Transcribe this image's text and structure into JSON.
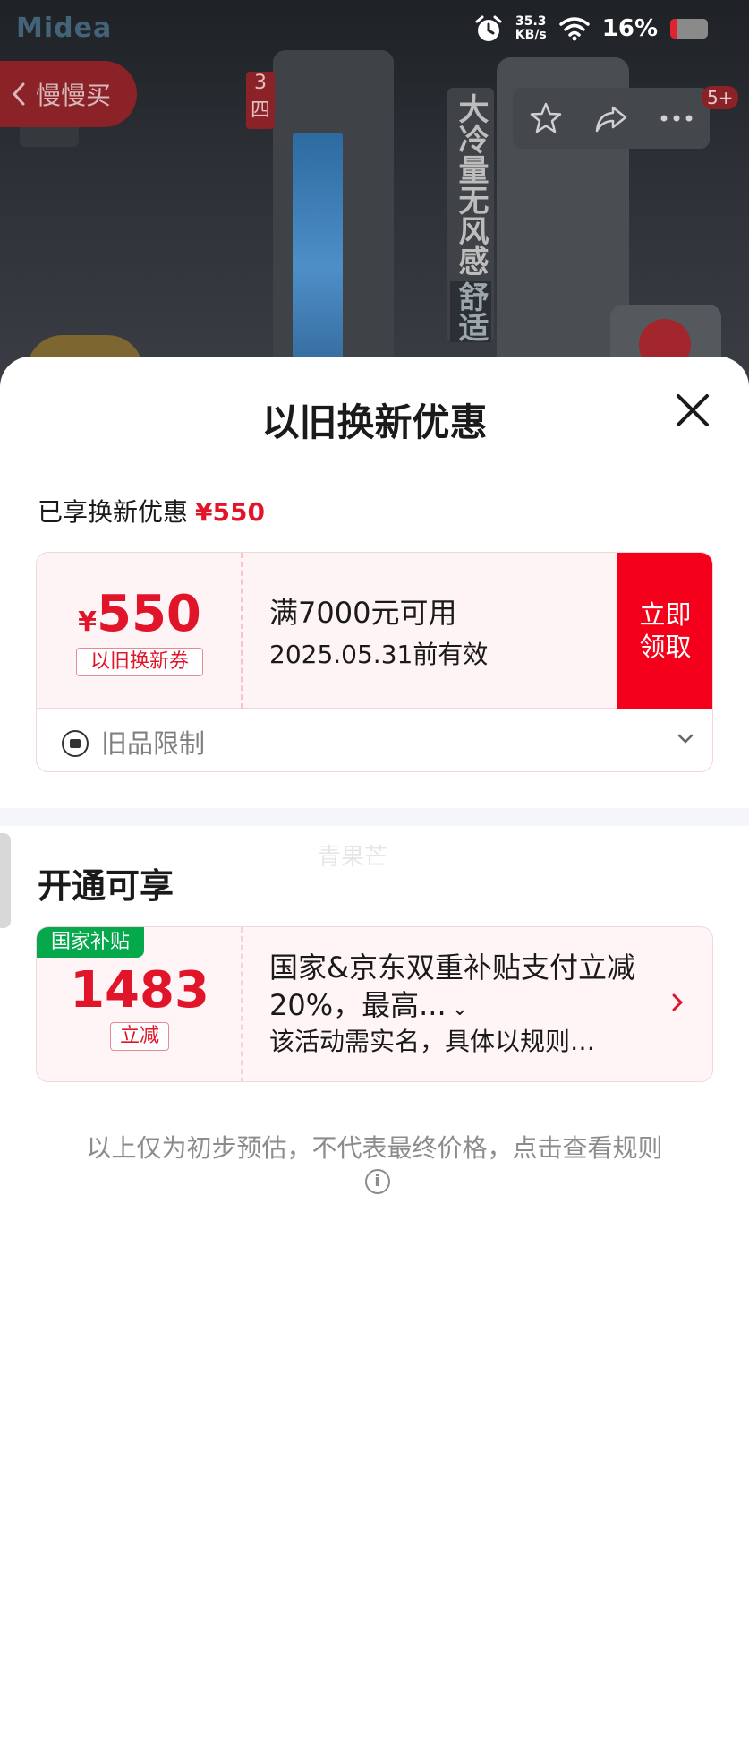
{
  "status_bar": {
    "network_speed_value": "35.3",
    "network_speed_unit": "KB/s",
    "battery_percent": "16%"
  },
  "background": {
    "brand_logo": "Midea",
    "slow_buy_label": "慢慢买",
    "tag_text": "3 四",
    "vertical_text": "大冷量无风感",
    "vertical_text_sub": "舒适",
    "notification_count": "5+"
  },
  "sheet": {
    "title": "以旧换新优惠",
    "enjoyed_label": "已享换新优惠",
    "enjoyed_amount": "¥550",
    "coupon": {
      "currency": "¥",
      "value": "550",
      "tag": "以旧换新券",
      "condition": "满7000元可用",
      "expiry": "2025.05.31前有效",
      "claim_label": "立即领取",
      "restriction_label": "旧品限制"
    },
    "watermark": "青果芒",
    "section_title": "开通可享",
    "subsidy": {
      "tag": "国家补贴",
      "amount": "1483",
      "amount_label": "立减",
      "description": "国家&京东双重补贴支付立减20%，最高...",
      "note": "该活动需实名，具体以规则…"
    },
    "disclaimer": "以上仅为初步预估，不代表最终价格，点击查看规则"
  },
  "colors": {
    "accent_red": "#e1152a",
    "claim_button": "#f5001b",
    "subsidy_green": "#05a84a"
  }
}
